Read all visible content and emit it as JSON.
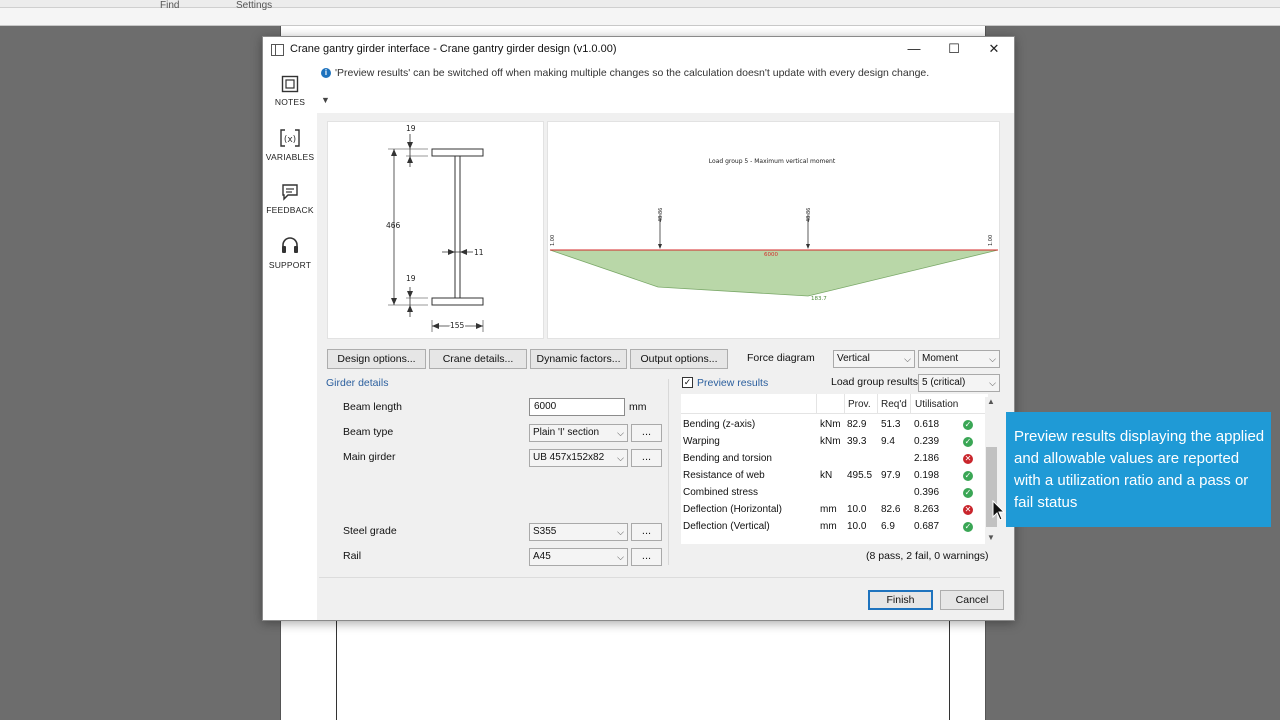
{
  "background": {
    "menu_left": "Find",
    "menu_right": "Settings"
  },
  "dialog": {
    "title": "Crane gantry girder interface - Crane gantry girder design (v1.0.00)",
    "minimize_glyph": "—",
    "maximize_glyph": "☐",
    "close_glyph": "✕"
  },
  "sidebar": {
    "items": [
      {
        "label": "NOTES",
        "icon": "notes-icon"
      },
      {
        "label": "VARIABLES",
        "icon": "variables-icon"
      },
      {
        "label": "FEEDBACK",
        "icon": "feedback-icon"
      },
      {
        "label": "SUPPORT",
        "icon": "headset-icon"
      }
    ]
  },
  "info": {
    "text": "'Preview results' can be switched off when making multiple changes so the calculation doesn't update with every design change.",
    "icon": "info-icon"
  },
  "section_drawing": {
    "flange_top": "19",
    "depth": "466",
    "web": "11",
    "flange_bottom": "19",
    "width": "155"
  },
  "force_diagram_panel": {
    "title": "Load group 5 - Maximum vertical moment",
    "left_label": "1.00",
    "right_label": "1.00",
    "span_label": "6000",
    "peak_label": "183.7",
    "load1": "48.86",
    "load2": "48.86"
  },
  "toolbar": {
    "design_options": "Design options...",
    "crane_details": "Crane details...",
    "dynamic_factors": "Dynamic factors...",
    "output_options": "Output options...",
    "force_diagram_label": "Force diagram",
    "direction": "Vertical",
    "effect": "Moment"
  },
  "girder": {
    "section_title": "Girder details",
    "beam_length_label": "Beam length",
    "beam_length_value": "6000",
    "beam_length_unit": "mm",
    "beam_type_label": "Beam type",
    "beam_type_value": "Plain 'I' section",
    "main_girder_label": "Main girder",
    "main_girder_value": "UB 457x152x82",
    "steel_grade_label": "Steel grade",
    "steel_grade_value": "S355",
    "rail_label": "Rail",
    "rail_value": "A45",
    "dots": "..."
  },
  "results": {
    "preview_label": "Preview results",
    "preview_checked": "✓",
    "load_group_label": "Load group results",
    "load_group_value": "5 (critical)",
    "headers": {
      "prov": "Prov.",
      "reqd": "Req'd",
      "util": "Utilisation"
    },
    "rows": [
      {
        "name": "Bending (z-axis)",
        "unit": "kNm",
        "prov": "82.9",
        "reqd": "51.3",
        "util": "0.618",
        "status": "pass"
      },
      {
        "name": "Warping",
        "unit": "kNm",
        "prov": "39.3",
        "reqd": "9.4",
        "util": "0.239",
        "status": "pass"
      },
      {
        "name": "Bending and torsion",
        "unit": "",
        "prov": "",
        "reqd": "",
        "util": "2.186",
        "status": "fail"
      },
      {
        "name": "Resistance of web",
        "unit": "kN",
        "prov": "495.5",
        "reqd": "97.9",
        "util": "0.198",
        "status": "pass"
      },
      {
        "name": "Combined stress",
        "unit": "",
        "prov": "",
        "reqd": "",
        "util": "0.396",
        "status": "pass"
      },
      {
        "name": "Deflection (Horizontal)",
        "unit": "mm",
        "prov": "10.0",
        "reqd": "82.6",
        "util": "8.263",
        "status": "fail"
      },
      {
        "name": "Deflection (Vertical)",
        "unit": "mm",
        "prov": "10.0",
        "reqd": "6.9",
        "util": "0.687",
        "status": "pass"
      }
    ],
    "summary": "(8 pass, 2 fail, 0 warnings)"
  },
  "footer": {
    "finish": "Finish",
    "cancel": "Cancel"
  },
  "callout": {
    "text": "Preview results displaying the applied and allowable values are reported with a utilization ratio and a pass or fail status"
  },
  "colors": {
    "accent": "#1f9ad6",
    "pass": "#3aa655",
    "fail": "#c9252c",
    "diagram_fill": "#b9d7a8",
    "beam_line": "#d42a2a"
  }
}
